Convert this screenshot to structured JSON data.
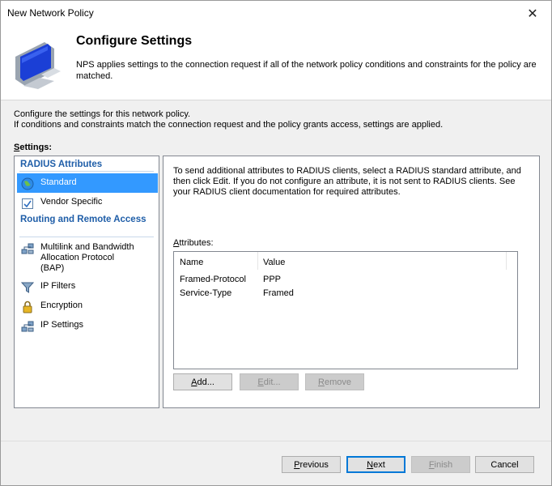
{
  "window": {
    "title": "New Network Policy",
    "close_glyph": "✕"
  },
  "header": {
    "title": "Configure Settings",
    "description": "NPS applies settings to the connection request if all of the network policy conditions and constraints for the policy are matched."
  },
  "intro": {
    "line1": "Configure the settings for this network policy.",
    "line2": "If conditions and constraints match the connection request and the policy grants access, settings are applied."
  },
  "settings_label": {
    "prefix": "S",
    "rest": "ettings:"
  },
  "sidebar": {
    "groups": [
      {
        "title": "RADIUS Attributes",
        "items": [
          {
            "label": "Standard",
            "icon": "globe-icon",
            "selected": true
          },
          {
            "label": "Vendor Specific",
            "icon": "checkbox-icon",
            "selected": false
          }
        ]
      },
      {
        "title": "Routing and Remote Access",
        "items": [
          {
            "label": "Multilink and Bandwidth Allocation Protocol (BAP)",
            "icon": "network-icon"
          },
          {
            "label": "IP Filters",
            "icon": "filter-icon"
          },
          {
            "label": "Encryption",
            "icon": "lock-icon"
          },
          {
            "label": "IP Settings",
            "icon": "network-icon"
          }
        ]
      }
    ]
  },
  "main": {
    "description": "To send additional attributes to RADIUS clients, select a RADIUS standard attribute, and then click Edit. If you do not configure an attribute, it is not sent to RADIUS clients. See your RADIUS client documentation for required attributes.",
    "attributes_label": {
      "prefix": "A",
      "rest": "ttributes:"
    },
    "columns": [
      "Name",
      "Value"
    ],
    "rows": [
      {
        "name": "Framed-Protocol",
        "value": "PPP"
      },
      {
        "name": "Service-Type",
        "value": "Framed"
      }
    ],
    "buttons": {
      "add": {
        "mnemonic": "A",
        "rest": "dd..."
      },
      "edit": {
        "mnemonic": "E",
        "rest": "dit..."
      },
      "remove": {
        "mnemonic": "R",
        "rest": "emove"
      }
    }
  },
  "footer": {
    "previous": {
      "mnemonic": "P",
      "rest": "revious"
    },
    "next": {
      "mnemonic": "N",
      "rest": "ext"
    },
    "finish": {
      "mnemonic": "F",
      "rest": "inish"
    },
    "cancel": "Cancel"
  },
  "colors": {
    "selection": "#3399ff",
    "group_title": "#1f5ea8",
    "default_button_border": "#0078d7"
  }
}
